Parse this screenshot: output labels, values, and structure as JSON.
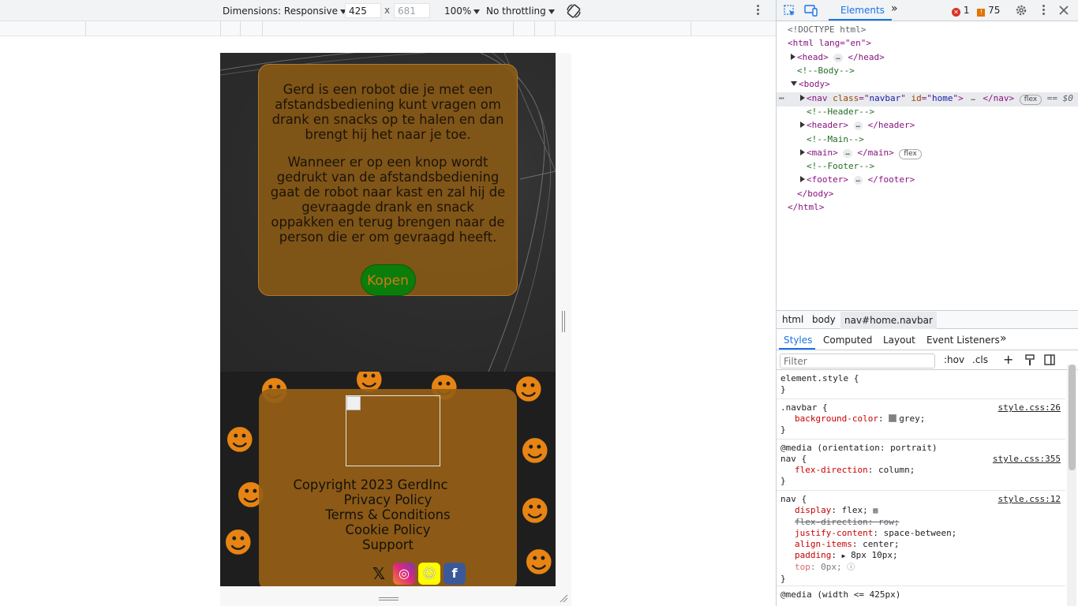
{
  "device_toolbar": {
    "dimensions_label": "Dimensions: Responsive",
    "width_value": "425",
    "height_value": "681",
    "times": "x",
    "zoom": "100%",
    "throttling": "No throttling"
  },
  "site": {
    "hero": {
      "paragraph1": "Gerd is een robot die je met een afstandsbediening kunt vragen om drank en snacks op te halen en dan brengt hij het naar je toe.",
      "paragraph2": "Wanneer er op een knop wordt gedrukt van de afstandsbediening gaat de robot naar kast en zal hij de gevraagde drank en snack oppakken en terug brengen naar de person die er om gevraagd heeft.",
      "buy_button": "Kopen"
    },
    "footer": {
      "copyright": "Copyright 2023 GerdInc",
      "links": [
        "Privacy Policy",
        "Terms & Conditions",
        "Cookie Policy",
        "Support"
      ],
      "socials": [
        "x-icon",
        "instagram-icon",
        "snapchat-icon",
        "facebook-icon"
      ]
    }
  },
  "devtools": {
    "tabs": {
      "elements": "Elements",
      "more": "»"
    },
    "errors_count": "1",
    "warnings_count": "75",
    "dom": {
      "doctype": "<!DOCTYPE html>",
      "html_open": "<html lang=\"en\">",
      "head": "head",
      "c_body": "<!--Body-->",
      "body": "body",
      "nav_class": "navbar",
      "nav_id": "home",
      "nav_pill": "flex",
      "selected_marker": "== $0",
      "c_header": "<!--Header-->",
      "header": "header",
      "c_main": "<!--Main-->",
      "main": "main",
      "main_pill": "flex",
      "c_footer": "<!--Footer-->",
      "footer": "footer",
      "body_close": "</body>",
      "html_close": "</html>"
    },
    "breadcrumbs": [
      "html",
      "body",
      "nav#home.navbar"
    ],
    "sub_tabs": [
      "Styles",
      "Computed",
      "Layout",
      "Event Listeners",
      "»"
    ],
    "filter_placeholder": "Filter",
    "filter_buttons": [
      ":hov",
      ".cls",
      "+"
    ],
    "styles": {
      "element_style": "element.style {",
      "r1_selector": ".navbar {",
      "r1_source": "style.css:26",
      "r1_prop": "background-color",
      "r1_value": "grey;",
      "r2_media": "@media (orientation: portrait)",
      "r2_selector": "nav {",
      "r2_source": "style.css:355",
      "r2_prop": "flex-direction",
      "r2_value": "column;",
      "r3_selector": "nav {",
      "r3_source": "style.css:12",
      "r3_props": [
        {
          "name": "display",
          "value": "flex;"
        },
        {
          "name": "flex-direction",
          "value": "row;"
        },
        {
          "name": "justify-content",
          "value": "space-between;"
        },
        {
          "name": "align-items",
          "value": "center;"
        },
        {
          "name": "padding",
          "value": "8px 10px;"
        },
        {
          "name": "top",
          "value": "0px;"
        }
      ],
      "r4_media": "@media (width <= 425px)",
      "close": "}"
    }
  }
}
